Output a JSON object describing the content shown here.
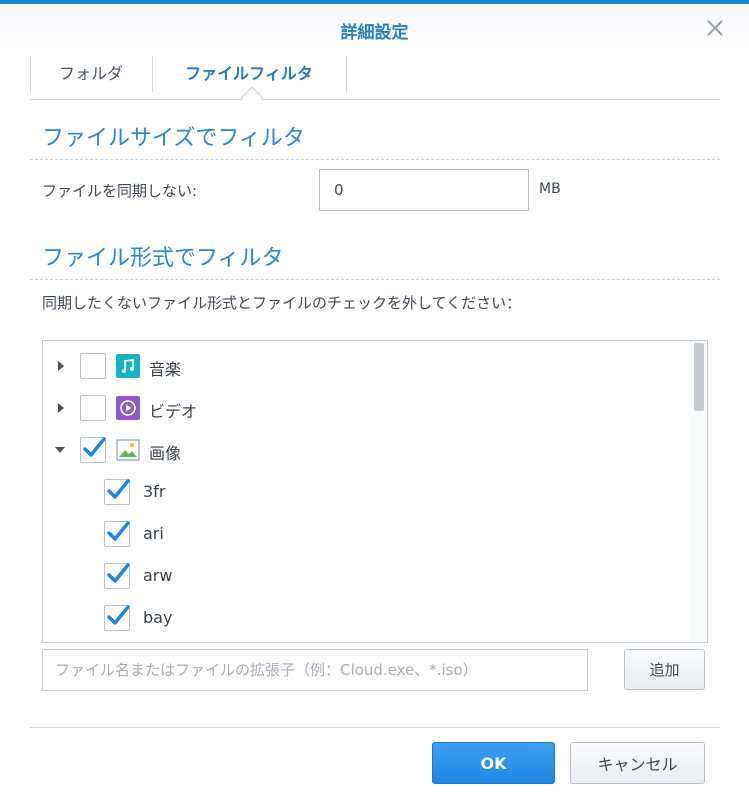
{
  "dialog": {
    "title": "詳細設定",
    "accent_color": "#1e88d8"
  },
  "tabs": [
    {
      "label": "フォルダ",
      "active": false
    },
    {
      "label": "ファイルフィルタ",
      "active": true
    }
  ],
  "size_filter": {
    "heading": "ファイルサイズでフィルタ",
    "label": "ファイルを同期しない:",
    "value": "0",
    "unit": "MB"
  },
  "type_filter": {
    "heading": "ファイル形式でフィルタ",
    "description": "同期したくないファイル形式とファイルのチェックを外してください："
  },
  "tree": [
    {
      "label": "音楽",
      "checked": false,
      "expanded": false,
      "icon": "music-icon"
    },
    {
      "label": "ビデオ",
      "checked": false,
      "expanded": false,
      "icon": "video-icon"
    },
    {
      "label": "画像",
      "checked": true,
      "expanded": true,
      "icon": "image-icon"
    },
    {
      "label": "3fr",
      "checked": true,
      "child": true
    },
    {
      "label": "ari",
      "checked": true,
      "child": true
    },
    {
      "label": "arw",
      "checked": true,
      "child": true
    },
    {
      "label": "bay",
      "checked": true,
      "child": true
    }
  ],
  "custom_filter": {
    "placeholder": "ファイル名またはファイルの拡張子（例：Cloud.exe、*.iso）",
    "add_label": "追加"
  },
  "footer": {
    "ok_label": "OK",
    "cancel_label": "キャンセル"
  }
}
